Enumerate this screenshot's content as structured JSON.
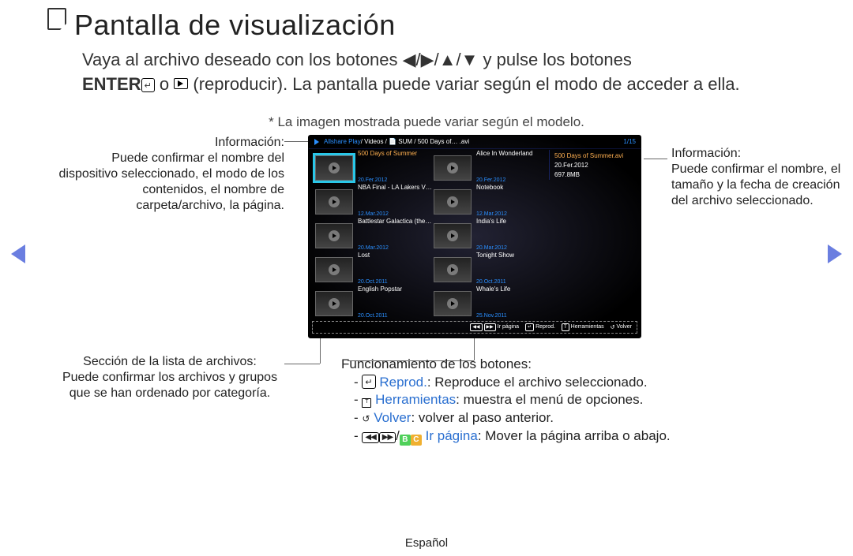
{
  "title": "Pantalla de visualización",
  "intro": {
    "part1": "Vaya al archivo deseado con los botones ",
    "arrows": "◀/▶/▲/▼",
    "part2": " y pulse los botones ",
    "enter_label": "ENTER",
    "part3": " o ",
    "part4": " (reproducir). La pantalla puede variar según el modo de acceder a ella."
  },
  "caption": "* La imagen mostrada puede variar según el modelo.",
  "screenshot": {
    "breadcrumb_app": "Allshare Play",
    "breadcrumb_path": " / Videos / 📄 SUM / 500 Days of… .avi",
    "page_indicator": "1/15",
    "files": [
      [
        {
          "title": "500 Days of Summer",
          "date": "20.Fer.2012",
          "selected": true,
          "highlight": true
        },
        {
          "title": "Alice In Wonderland",
          "date": "20.Fer.2012"
        }
      ],
      [
        {
          "title": "NBA Final - LA Lakers VS…",
          "date": "12.Mar.2012"
        },
        {
          "title": "Notebook",
          "date": "12.Mar.2012"
        }
      ],
      [
        {
          "title": "Battlestar Galactica (the…",
          "date": "20.Mar.2012"
        },
        {
          "title": "India's Life",
          "date": "20.Mar.2012"
        }
      ],
      [
        {
          "title": "Lost",
          "date": "20.Oct.2011"
        },
        {
          "title": "Tonight Show",
          "date": "20.Oct.2011"
        }
      ],
      [
        {
          "title": "English Popstar",
          "date": "20.Oct.2011"
        },
        {
          "title": "Whale's Life",
          "date": "25.Nov.2011"
        }
      ]
    ],
    "info_panel": {
      "filename": "500 Days of Summer.avi",
      "date": "20.Fer.2012",
      "size": "697.8MB"
    },
    "bottom_bar": {
      "page": "Ir página",
      "play": "Reprod.",
      "tools": "Herramientas",
      "return": "Volver"
    }
  },
  "callouts": {
    "info_left_head": "Información:",
    "info_left_body": "Puede confirmar el nombre del dispositivo seleccionado, el modo de los contenidos, el nombre de carpeta/archivo, la página.",
    "file_list_head": "Sección de la lista de archivos:",
    "file_list_body": "Puede confirmar los archivos y grupos que se han ordenado por categoría.",
    "info_right_head": "Información:",
    "info_right_body": "Puede confirmar el nombre, el tamaño y la fecha de creación del archivo seleccionado."
  },
  "functions": {
    "head": "Funcionamiento de los botones:",
    "play_term": "Reprod.",
    "play_desc": ": Reproduce el archivo seleccionado.",
    "tools_term": "Herramientas",
    "tools_desc": ": muestra el menú de opciones.",
    "return_term": "Volver",
    "return_desc": ": volver al paso anterior.",
    "page_term": "Ir página",
    "page_desc": ": Mover la página arriba o abajo."
  },
  "footer": "Español"
}
